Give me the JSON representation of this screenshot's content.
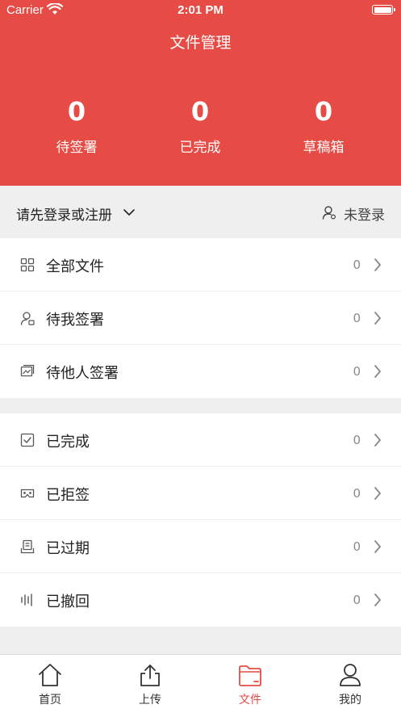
{
  "status_bar": {
    "carrier": "Carrier",
    "time": "2:01 PM"
  },
  "header": {
    "title": "文件管理",
    "stats": [
      {
        "value": "0",
        "label": "待签署"
      },
      {
        "value": "0",
        "label": "已完成"
      },
      {
        "value": "0",
        "label": "草稿箱"
      }
    ]
  },
  "login_bar": {
    "prompt": "请先登录或注册",
    "status": "未登录"
  },
  "list_primary": [
    {
      "label": "全部文件",
      "count": "0",
      "icon": "grid-icon"
    },
    {
      "label": "待我签署",
      "count": "0",
      "icon": "user-sign-icon"
    },
    {
      "label": "待他人签署",
      "count": "0",
      "icon": "image-frame-icon"
    }
  ],
  "list_secondary": [
    {
      "label": "已完成",
      "count": "0",
      "icon": "checkbox-icon"
    },
    {
      "label": "已拒签",
      "count": "0",
      "icon": "vr-glasses-icon"
    },
    {
      "label": "已过期",
      "count": "0",
      "icon": "archive-icon"
    },
    {
      "label": "已撤回",
      "count": "0",
      "icon": "bars-icon"
    }
  ],
  "tabs": [
    {
      "label": "首页",
      "icon": "home-icon",
      "active": false
    },
    {
      "label": "上传",
      "icon": "upload-icon",
      "active": false
    },
    {
      "label": "文件",
      "icon": "folder-icon",
      "active": true
    },
    {
      "label": "我的",
      "icon": "person-icon",
      "active": false
    }
  ],
  "colors": {
    "accent": "#e64c45",
    "background": "#efefef",
    "text": "#222222",
    "muted": "#8a8a8a"
  }
}
